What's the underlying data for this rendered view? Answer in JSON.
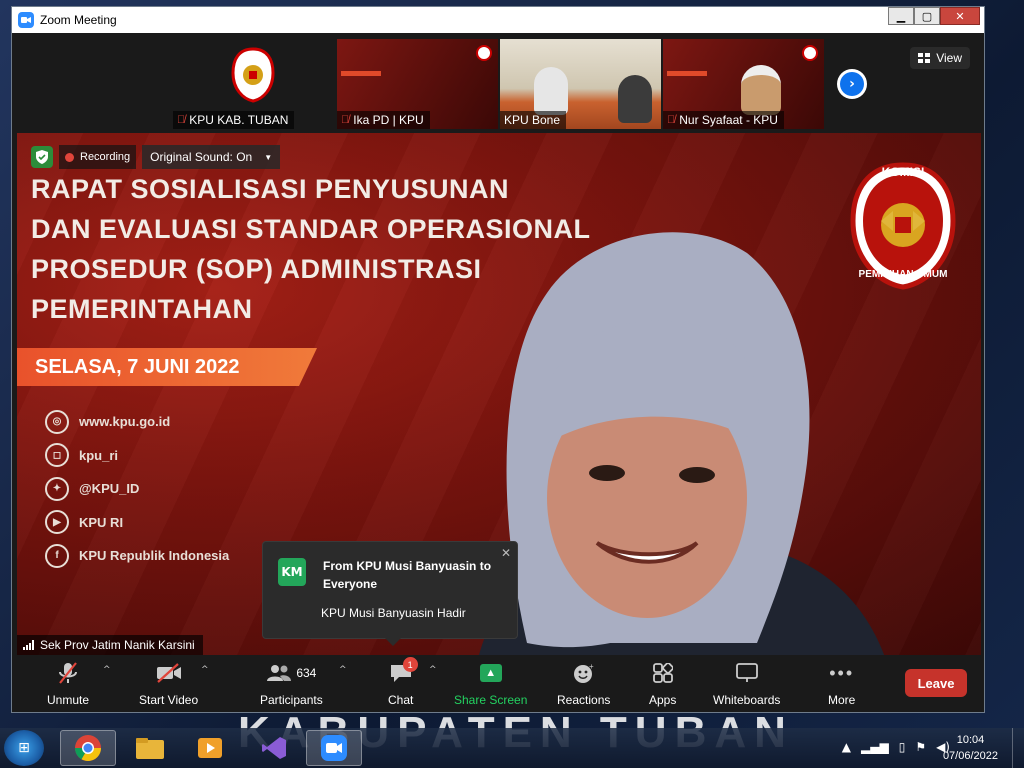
{
  "window": {
    "title": "Zoom Meeting"
  },
  "strip": {
    "thumbnails": [
      {
        "label": "KPU KAB. TUBAN",
        "muted": true
      },
      {
        "label": "Ika PD | KPU",
        "muted": true
      },
      {
        "label": "KPU Bone",
        "muted": false
      },
      {
        "label": "Nur Syafaat - KPU",
        "muted": true
      }
    ],
    "view_label": "View"
  },
  "main": {
    "recording_label": "Recording",
    "sound_label": "Original Sound: On",
    "slide_title": "RAPAT SOSIALISASI PENYUSUNAN\nDAN EVALUASI STANDAR OPERASIONAL\nPROSEDUR (SOP) ADMINISTRASI\nPEMERINTAHAN",
    "date": "SELASA, 7 JUNI 2022",
    "socials": [
      "www.kpu.go.id",
      "kpu_ri",
      "@KPU_ID",
      "KPU RI",
      "KPU Republik Indonesia"
    ],
    "logo_top": "KOMISI",
    "logo_bottom": "PEMILIHAN UMUM",
    "speaker": "Sek Prov  Jatim Nanik Karsini"
  },
  "chat": {
    "avatar": "KM",
    "from": "From KPU Musi Banyuasin to Everyone",
    "message": "KPU Musi Banyuasin Hadir"
  },
  "toolbar": {
    "unmute": "Unmute",
    "start_video": "Start Video",
    "participants": "Participants",
    "participants_count": "634",
    "chat": "Chat",
    "chat_badge": "1",
    "share": "Share Screen",
    "reactions": "Reactions",
    "apps": "Apps",
    "whiteboards": "Whiteboards",
    "more": "More",
    "leave": "Leave"
  },
  "overlay_text": "KABUPATEN TUBAN",
  "taskbar": {
    "time": "10:04",
    "date": "07/06/2022"
  },
  "colors": {
    "zoom_blue": "#2d8cff",
    "leave_red": "#c6332b",
    "share_green": "#23a65a",
    "slide_red": "#7a140e"
  }
}
